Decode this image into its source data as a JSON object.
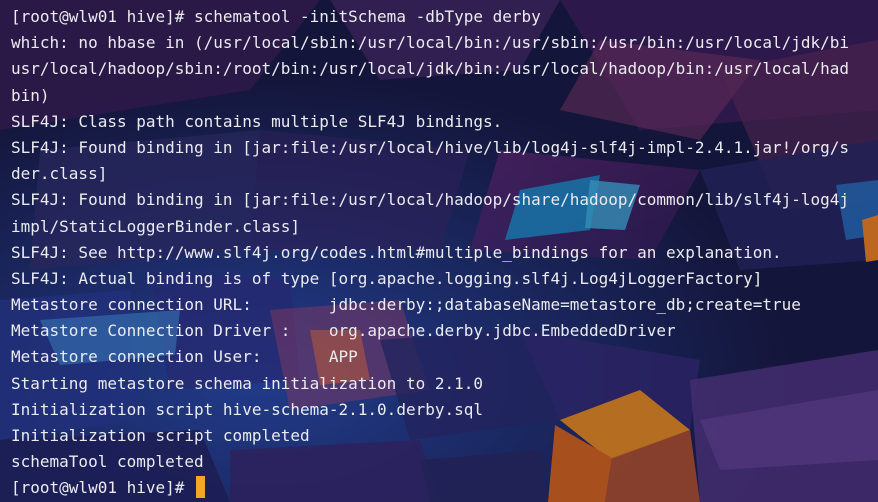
{
  "terminal": {
    "lines": [
      "[root@wlw01 hive]# schematool -initSchema -dbType derby",
      "which: no hbase in (/usr/local/sbin:/usr/local/bin:/usr/sbin:/usr/bin:/usr/local/jdk/bi",
      "usr/local/hadoop/sbin:/root/bin:/usr/local/jdk/bin:/usr/local/hadoop/bin:/usr/local/had",
      "bin)",
      "SLF4J: Class path contains multiple SLF4J bindings.",
      "SLF4J: Found binding in [jar:file:/usr/local/hive/lib/log4j-slf4j-impl-2.4.1.jar!/org/s",
      "der.class]",
      "SLF4J: Found binding in [jar:file:/usr/local/hadoop/share/hadoop/common/lib/slf4j-log4j",
      "impl/StaticLoggerBinder.class]",
      "SLF4J: See http://www.slf4j.org/codes.html#multiple_bindings for an explanation.",
      "SLF4J: Actual binding is of type [org.apache.logging.slf4j.Log4jLoggerFactory]",
      "Metastore connection URL:        jdbc:derby:;databaseName=metastore_db;create=true",
      "Metastore Connection Driver :    org.apache.derby.jdbc.EmbeddedDriver",
      "Metastore connection User:       APP",
      "Starting metastore schema initialization to 2.1.0",
      "Initialization script hive-schema-2.1.0.derby.sql",
      "Initialization script completed",
      "schemaTool completed"
    ],
    "prompt": "[root@wlw01 hive]# "
  },
  "colors": {
    "text": "#ebebf0",
    "cursor": "#f5a623"
  }
}
